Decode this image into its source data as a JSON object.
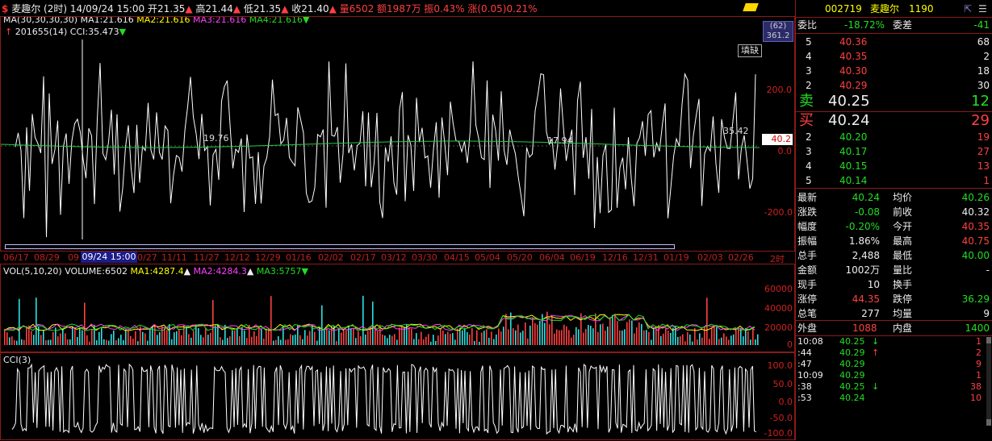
{
  "header": {
    "icon": "dollar-icon",
    "name": "麦趣尔",
    "period": "(2时)",
    "datetime": "14/09/24 15:00",
    "open": "开21.35",
    "high": "高21.44",
    "low": "低21.35",
    "close": "收21.40",
    "volume": "量6502",
    "amount": "额1987万",
    "amplitude": "振0.43%",
    "change": "涨(0.05)0.21%"
  },
  "ma_line": {
    "label": "MA(30,30,30,30)",
    "ma1": "MA1:21.616",
    "ma2": "MA2:21.616",
    "ma3": "MA3:21.616",
    "ma4": "MA4:21.616"
  },
  "cci_line": {
    "code": "201655(14)",
    "cci": "CCI:35.473"
  },
  "price_axis": {
    "badge": "(62)",
    "badge_value": "361.2",
    "fill_button": "填缺",
    "labels": [
      "200.0",
      "0.0",
      "-200.0"
    ],
    "current": "40.2",
    "annotation_left": "19.76",
    "annotation_mid": "17.94",
    "annotation_right": "35.42",
    "period_label": "2时"
  },
  "dates": [
    "06/17",
    "08/29",
    "09",
    "09/24 15:00",
    "0/27",
    "11/11",
    "11/27",
    "12/12",
    "12/29",
    "01/16",
    "02/02",
    "02/17",
    "03/12",
    "03/30",
    "04/15",
    "05/04",
    "05/20",
    "06/04",
    "06/19",
    "12/16",
    "12/31",
    "01/19",
    "02/03",
    "02/26"
  ],
  "volume_panel": {
    "label": "VOL(5,10,20)",
    "volume": "VOLUME:6502",
    "ma1": "MA1:4287.4",
    "ma2": "MA2:4284.3",
    "ma3": "MA3:5757",
    "axis": [
      "60000",
      "40000",
      "20000",
      "0"
    ]
  },
  "cci_panel": {
    "label": "CCI(3)",
    "axis": [
      "100.0",
      "50.0",
      "0.0",
      "-50.0",
      "-100.0"
    ]
  },
  "quote": {
    "code": "002719",
    "name": "麦趣尔",
    "number": "1190",
    "weibi_label": "委比",
    "weibi": "-18.72%",
    "weicha_label": "委差",
    "weicha": "-41",
    "sell": [
      {
        "level": "5",
        "price": "40.36",
        "vol": "68"
      },
      {
        "level": "4",
        "price": "40.35",
        "vol": "2"
      },
      {
        "level": "3",
        "price": "40.30",
        "vol": "18"
      },
      {
        "level": "2",
        "price": "40.29",
        "vol": "30"
      }
    ],
    "sell1": {
      "label": "卖",
      "price": "40.25",
      "vol": "12"
    },
    "buy1": {
      "label": "买",
      "price": "40.24",
      "vol": "29"
    },
    "buy": [
      {
        "level": "2",
        "price": "40.20",
        "vol": "19"
      },
      {
        "level": "3",
        "price": "40.17",
        "vol": "27"
      },
      {
        "level": "4",
        "price": "40.15",
        "vol": "13"
      },
      {
        "level": "5",
        "price": "40.14",
        "vol": "1"
      }
    ],
    "stats": [
      {
        "l1": "最新",
        "v1": "40.24",
        "c1": "green",
        "l2": "均价",
        "v2": "40.26",
        "c2": "green"
      },
      {
        "l1": "涨跌",
        "v1": "-0.08",
        "c1": "green",
        "l2": "前收",
        "v2": "40.32",
        "c2": "white"
      },
      {
        "l1": "幅度",
        "v1": "-0.20%",
        "c1": "green",
        "l2": "今开",
        "v2": "40.35",
        "c2": "red"
      },
      {
        "l1": "振幅",
        "v1": "1.86%",
        "c1": "white",
        "l2": "最高",
        "v2": "40.75",
        "c2": "red"
      },
      {
        "l1": "总手",
        "v1": "2,488",
        "c1": "white",
        "l2": "最低",
        "v2": "40.00",
        "c2": "green"
      },
      {
        "l1": "金额",
        "v1": "1002万",
        "c1": "white",
        "l2": "量比",
        "v2": "-",
        "c2": "white"
      },
      {
        "l1": "现手",
        "v1": "10",
        "c1": "white",
        "l2": "换手",
        "v2": "",
        "c2": "white"
      },
      {
        "l1": "涨停",
        "v1": "44.35",
        "c1": "red",
        "l2": "跌停",
        "v2": "36.29",
        "c2": "green"
      },
      {
        "l1": "总笔",
        "v1": "277",
        "c1": "white",
        "l2": "均量",
        "v2": "9",
        "c2": "white"
      }
    ],
    "waipan_label": "外盘",
    "waipan": "1088",
    "neipan_label": "内盘",
    "neipan": "1400",
    "ticks": [
      {
        "time": "10:08",
        "price": "40.25",
        "arrow": "↓",
        "ac": "green",
        "vol": "1"
      },
      {
        "time": ":44",
        "price": "40.29",
        "arrow": "↑",
        "ac": "red",
        "vol": "2"
      },
      {
        "time": ":47",
        "price": "40.29",
        "arrow": "",
        "ac": "red",
        "vol": "9"
      },
      {
        "time": "10:09",
        "price": "40.29",
        "arrow": "",
        "ac": "red",
        "vol": "1"
      },
      {
        "time": ":38",
        "price": "40.25",
        "arrow": "↓",
        "ac": "green",
        "vol": "38"
      },
      {
        "time": ":53",
        "price": "40.24",
        "arrow": "",
        "ac": "green",
        "vol": "10"
      }
    ]
  },
  "colors": {
    "red": "#ff4040",
    "green": "#22dd22",
    "border": "#8a1a1a"
  }
}
